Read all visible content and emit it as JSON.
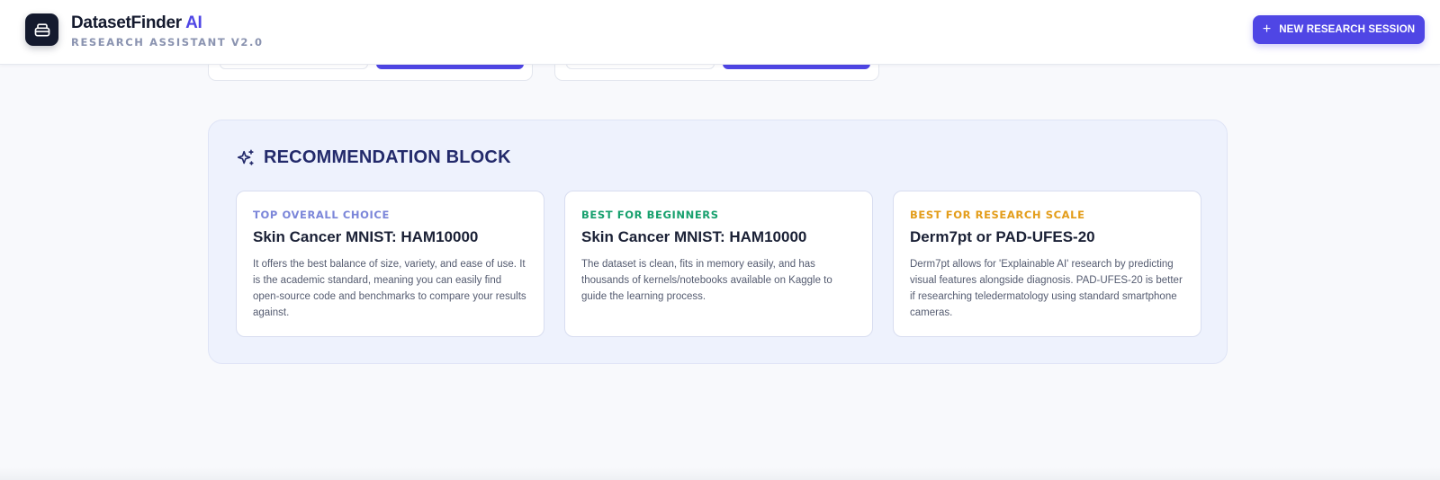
{
  "header": {
    "brand_name": "DatasetFinder",
    "brand_suffix": "AI",
    "subtitle": "RESEARCH ASSISTANT V2.0",
    "logo_icon": "archive-box-icon",
    "new_session_button": "NEW RESEARCH SESSION",
    "new_session_icon": "plus-icon"
  },
  "recommendation_block": {
    "title": "RECOMMENDATION BLOCK",
    "icon": "sparkles-icon",
    "cards": [
      {
        "tag": "TOP OVERALL CHOICE",
        "tag_color": "#7b86d9",
        "title": "Skin Cancer MNIST: HAM10000",
        "body": "It offers the best balance of size, variety, and ease of use. It is the academic standard, meaning you can easily find open-source code and benchmarks to compare your results against."
      },
      {
        "tag": "BEST FOR BEGINNERS",
        "tag_color": "#16a06d",
        "title": "Skin Cancer MNIST: HAM10000",
        "body": "The dataset is clean, fits in memory easily, and has thousands of kernels/notebooks available on Kaggle to guide the learning process."
      },
      {
        "tag": "BEST FOR RESEARCH SCALE",
        "tag_color": "#e39d1a",
        "title": "Derm7pt or PAD-UFES-20",
        "body": "Derm7pt allows for 'Explainable AI' research by predicting visual features alongside diagnosis. PAD-UFES-20 is better if researching teledermatology using standard smartphone cameras."
      }
    ]
  },
  "colors": {
    "accent": "#4f46e5",
    "dark": "#141a2e",
    "block_background": "#eef2fd"
  }
}
